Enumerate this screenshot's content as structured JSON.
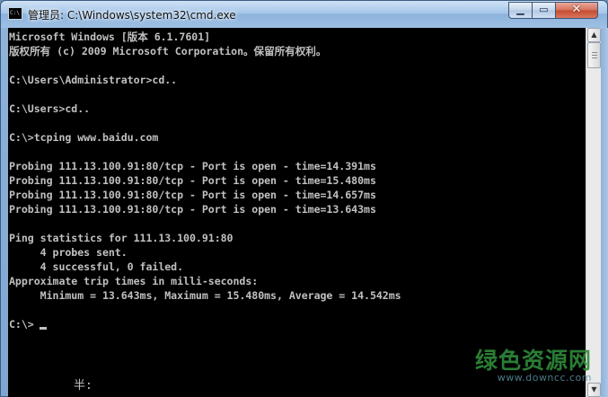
{
  "window": {
    "title": "管理员: C:\\Windows\\system32\\cmd.exe",
    "app_icon_text": "C:\\",
    "controls": {
      "minimize": "minimize-icon",
      "maximize": "maximize-icon",
      "close": "close-icon"
    }
  },
  "console": {
    "lines": [
      "Microsoft Windows [版本 6.1.7601]",
      "版权所有 (c) 2009 Microsoft Corporation。保留所有权利。",
      "",
      "C:\\Users\\Administrator>cd..",
      "",
      "C:\\Users>cd..",
      "",
      "C:\\>tcping www.baidu.com",
      "",
      "Probing 111.13.100.91:80/tcp - Port is open - time=14.391ms",
      "Probing 111.13.100.91:80/tcp - Port is open - time=15.480ms",
      "Probing 111.13.100.91:80/tcp - Port is open - time=14.657ms",
      "Probing 111.13.100.91:80/tcp - Port is open - time=13.643ms",
      "",
      "Ping statistics for 111.13.100.91:80",
      "     4 probes sent.",
      "     4 successful, 0 failed.",
      "Approximate trip times in milli-seconds:",
      "     Minimum = 13.643ms, Maximum = 15.480ms, Average = 14.542ms",
      "",
      "C:\\>"
    ],
    "ime_indicator": "半:",
    "text_color": "#c0c0c0",
    "background_color": "#000000"
  },
  "watermark": {
    "main": "绿色资源网",
    "url": "www.downcc.com"
  }
}
